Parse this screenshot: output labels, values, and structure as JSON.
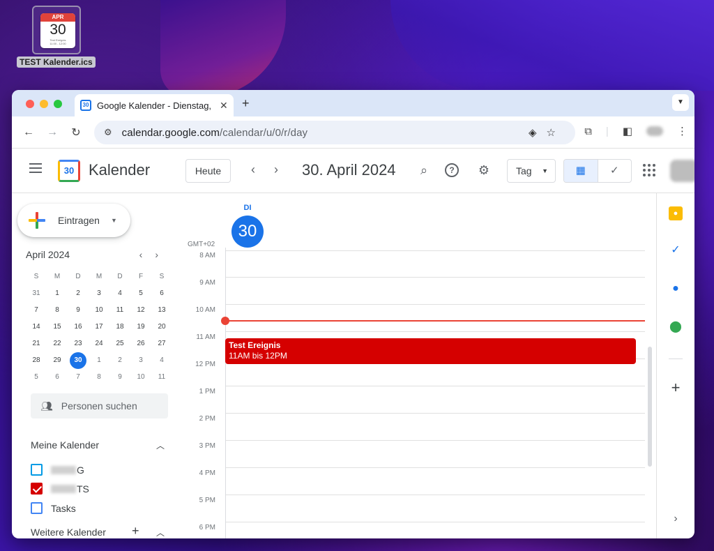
{
  "desktop": {
    "file_icon": {
      "month": "APR",
      "day": "30",
      "line1": "Test Ereignis",
      "line2": "11:00 - 12:00"
    },
    "file_label": "TEST Kalender.ics"
  },
  "browser": {
    "tab_title": "Google Kalender - Dienstag,",
    "url_host": "calendar.google.com",
    "url_path": "/calendar/u/0/r/day"
  },
  "header": {
    "brand": "Kalender",
    "logo_day": "30",
    "today_button": "Heute",
    "date_title": "30. April 2024",
    "view_select": "Tag"
  },
  "sidebar": {
    "create_label": "Eintragen",
    "mini_calendar": {
      "title": "April 2024",
      "weekdays": [
        "S",
        "M",
        "D",
        "M",
        "D",
        "F",
        "S"
      ],
      "weeks": [
        [
          "31",
          "1",
          "2",
          "3",
          "4",
          "5",
          "6"
        ],
        [
          "7",
          "8",
          "9",
          "10",
          "11",
          "12",
          "13"
        ],
        [
          "14",
          "15",
          "16",
          "17",
          "18",
          "19",
          "20"
        ],
        [
          "21",
          "22",
          "23",
          "24",
          "25",
          "26",
          "27"
        ],
        [
          "28",
          "29",
          "30",
          "1",
          "2",
          "3",
          "4"
        ],
        [
          "5",
          "6",
          "7",
          "8",
          "9",
          "10",
          "11"
        ]
      ],
      "selected_day": "30"
    },
    "people_search_placeholder": "Personen suchen",
    "my_calendars_title": "Meine Kalender",
    "my_calendars": [
      {
        "label_suffix": "G",
        "color": "#039be5",
        "checked": false
      },
      {
        "label_suffix": "TS",
        "color": "#d50000",
        "checked": true
      },
      {
        "label": "Tasks",
        "color": "#4285f4",
        "checked": false
      }
    ],
    "other_calendars_title": "Weitere Kalender"
  },
  "day_view": {
    "day_of_week": "DI",
    "day_number": "30",
    "timezone": "GMT+02",
    "hours": [
      "8 AM",
      "9 AM",
      "10 AM",
      "11 AM",
      "12 PM",
      "1 PM",
      "2 PM",
      "3 PM",
      "4 PM",
      "5 PM",
      "6 PM"
    ],
    "event": {
      "title": "Test Ereignis",
      "time": "11AM bis 12PM",
      "color": "#d50000"
    }
  },
  "colors": {
    "accent": "#1a73e8",
    "now_line": "#ea4335"
  }
}
